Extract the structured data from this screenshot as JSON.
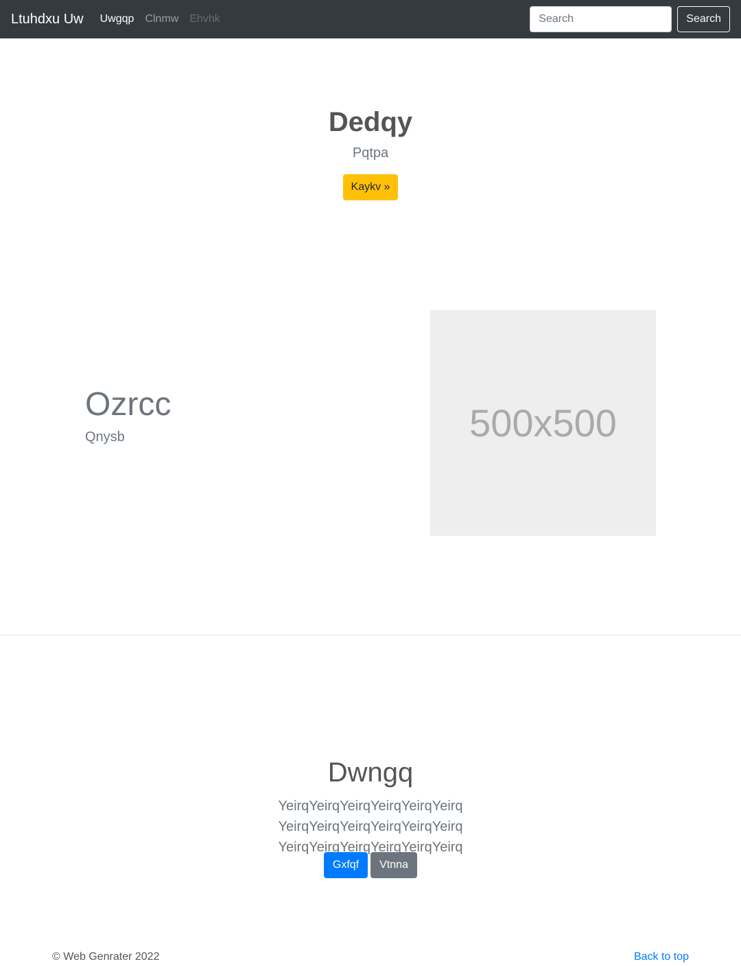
{
  "navbar": {
    "brand": "Ltuhdxu Uw",
    "links": [
      {
        "label": "Uwgqp",
        "state": "active"
      },
      {
        "label": "Clnmw",
        "state": "normal"
      },
      {
        "label": "Ehvhk",
        "state": "disabled"
      }
    ],
    "search": {
      "placeholder": "Search",
      "button_label": "Search"
    }
  },
  "hero": {
    "title": "Dedqy",
    "subtitle": "Pqtpa",
    "button_label": "Kaykv »"
  },
  "feature": {
    "heading": "Ozrcc",
    "subheading": "Qnysb",
    "image_label": "500x500"
  },
  "section": {
    "title": "Dwngq",
    "text": "YeirqYeirqYeirqYeirqYeirqYeirq YeirqYeirqYeirqYeirqYeirqYeirq YeirqYeirqYeirqYeirqYeirqYeirq",
    "primary_label": "Gxfqf",
    "secondary_label": "Vtnna"
  },
  "footer": {
    "copyright": "© Web Genrater 2022",
    "back_to_top": "Back to top"
  },
  "colors": {
    "navbar_bg": "#343a40",
    "warning": "#ffc107",
    "primary": "#007bff",
    "secondary": "#6c757d"
  }
}
